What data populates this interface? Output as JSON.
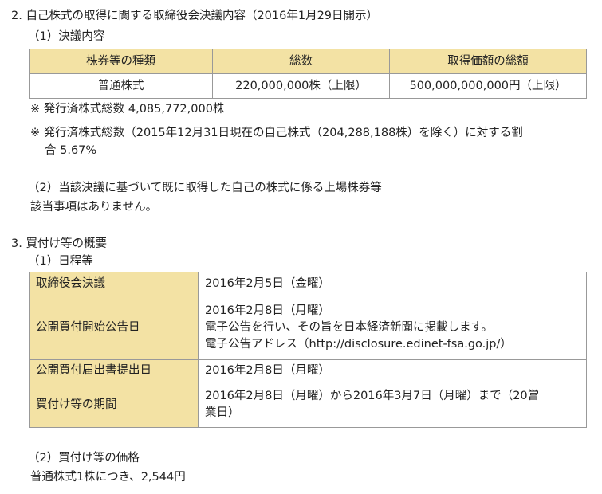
{
  "section2": {
    "heading": "2. 自己株式の取得に関する取締役会決議内容（2016年1月29日開示）",
    "sub1": "（1）決議内容",
    "table": {
      "headers": [
        "株券等の種類",
        "総数",
        "取得価額の総額"
      ],
      "row": [
        "普通株式",
        "220,000,000株（上限）",
        "500,000,000,000円（上限）"
      ]
    },
    "note1": "※ 発行済株式総数 4,085,772,000株",
    "note2_line1": "※ 発行済株式総数（2015年12月31日現在の自己株式（204,288,188株）を除く）に対する割",
    "note2_line2": "合 5.67%",
    "sub2": "（2）当該決議に基づいて既に取得した自己の株式に係る上場株券等",
    "sub2_text": "該当事項はありません。"
  },
  "section3": {
    "heading": "3. 買付け等の概要",
    "sub1": "（1）日程等",
    "schedule": [
      {
        "label": "取締役会決議",
        "lines": [
          "2016年2月5日（金曜）"
        ]
      },
      {
        "label": "公開買付開始公告日",
        "lines": [
          "2016年2月8日（月曜）",
          "電子公告を行い、その旨を日本経済新聞に掲載します。",
          "電子公告アドレス（http://disclosure.edinet-fsa.go.jp/）"
        ]
      },
      {
        "label": "公開買付届出書提出日",
        "lines": [
          "2016年2月8日（月曜）"
        ]
      },
      {
        "label": "買付け等の期間",
        "lines": [
          "2016年2月8日（月曜）から2016年3月7日（月曜）まで（20営",
          "業日）"
        ]
      }
    ],
    "sub2": "（2）買付け等の価格",
    "price_text": "普通株式1株につき、2,544円"
  }
}
